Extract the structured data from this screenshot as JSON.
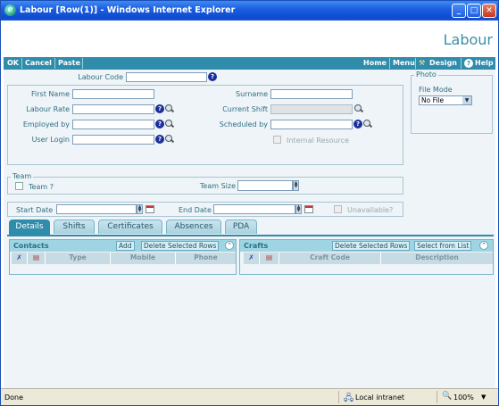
{
  "window": {
    "title": "Labour [Row(1)] - Windows Internet Explorer"
  },
  "page": {
    "title": "Labour"
  },
  "toolbar": {
    "ok": "OK",
    "cancel": "Cancel",
    "paste": "Paste",
    "home": "Home",
    "menu": "Menu",
    "design": "Design",
    "help": "Help"
  },
  "form": {
    "labour_code": "Labour Code",
    "first_name": "First Name",
    "surname": "Surname",
    "labour_rate": "Labour Rate",
    "current_shift": "Current Shift",
    "employed_by": "Employed by",
    "scheduled_by": "Scheduled by",
    "user_login": "User Login",
    "internal_resource": "Internal Resource"
  },
  "photo": {
    "legend": "Photo",
    "file_mode_label": "File Mode",
    "file_mode_value": "No File"
  },
  "team": {
    "legend": "Team",
    "team_check": "Team ?",
    "team_size": "Team Size"
  },
  "dates": {
    "start_date": "Start Date",
    "end_date": "End Date",
    "unavailable": "Unavailable?"
  },
  "tabs": [
    "Details",
    "Shifts",
    "Certificates",
    "Absences",
    "PDA"
  ],
  "contacts": {
    "title": "Contacts",
    "add": "Add",
    "delete": "Delete Selected Rows",
    "columns": [
      "Type",
      "Mobile",
      "Phone"
    ]
  },
  "crafts": {
    "title": "Crafts",
    "delete": "Delete Selected Rows",
    "select": "Select from List",
    "columns": [
      "Craft Code",
      "Description"
    ]
  },
  "statusbar": {
    "status": "Done",
    "zone": "Local intranet",
    "zoom": "100%"
  }
}
